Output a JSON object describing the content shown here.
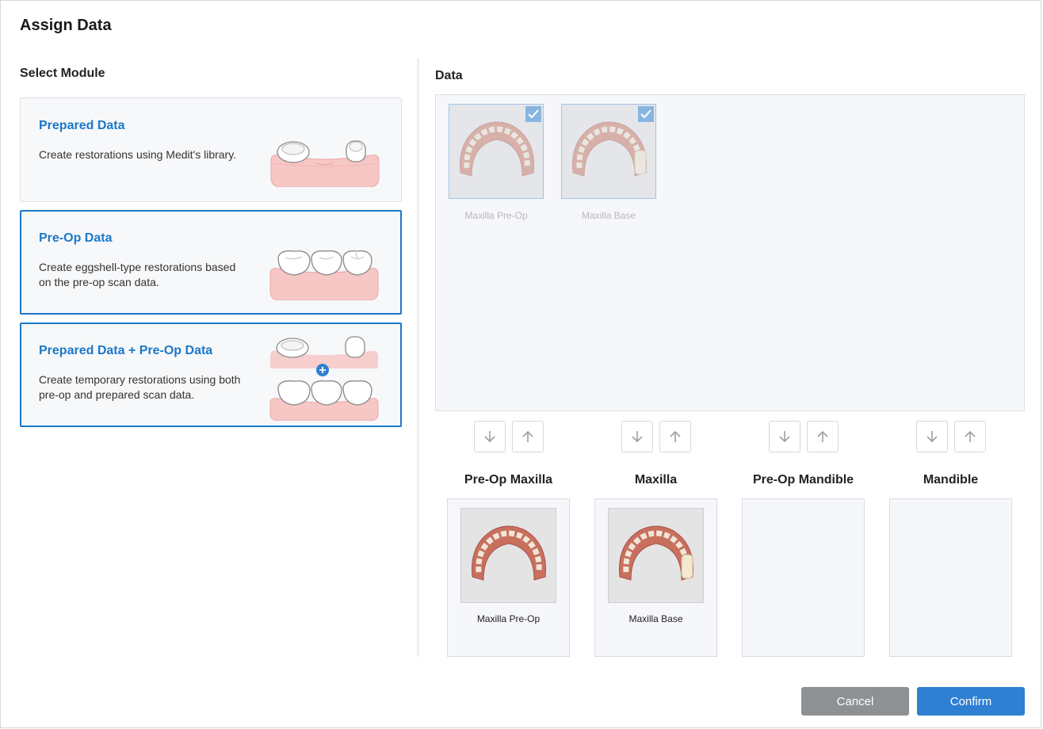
{
  "dialog": {
    "title": "Assign Data"
  },
  "select_module": {
    "heading": "Select Module",
    "modules": [
      {
        "title": "Prepared Data",
        "description": "Create restorations using Medit's library."
      },
      {
        "title": "Pre-Op Data",
        "description": "Create eggshell-type restorations based on the pre-op scan data."
      },
      {
        "title": "Prepared Data + Pre-Op Data",
        "description": "Create temporary restorations using both pre-op and prepared scan data."
      }
    ]
  },
  "data": {
    "heading": "Data",
    "items": [
      {
        "label": "Maxilla Pre-Op",
        "checked": true
      },
      {
        "label": "Maxilla Base",
        "checked": true
      }
    ]
  },
  "slots": [
    {
      "title": "Pre-Op Maxilla",
      "assigned": "Maxilla Pre-Op"
    },
    {
      "title": "Maxilla",
      "assigned": "Maxilla Base"
    },
    {
      "title": "Pre-Op Mandible",
      "assigned": ""
    },
    {
      "title": "Mandible",
      "assigned": ""
    }
  ],
  "footer": {
    "cancel_label": "Cancel",
    "confirm_label": "Confirm"
  },
  "colors": {
    "accent": "#1b78c9",
    "confirm": "#2f7fd2",
    "cancel": "#8e9194"
  }
}
